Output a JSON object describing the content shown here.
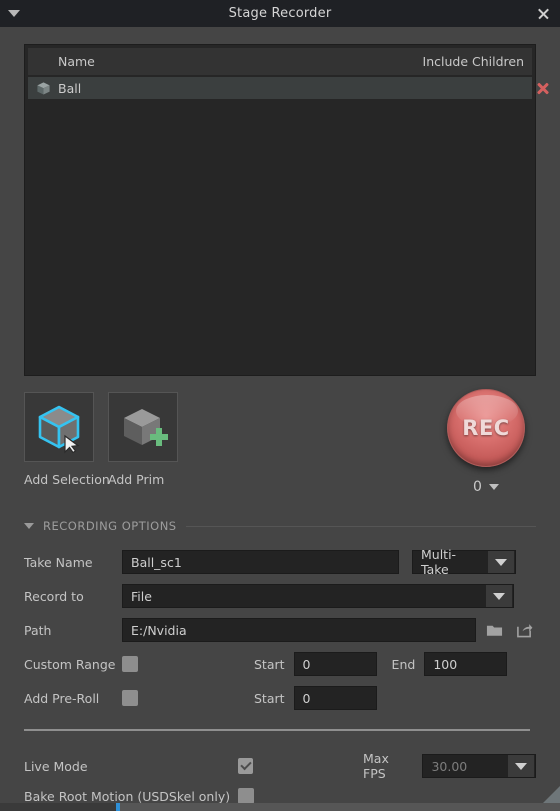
{
  "titlebar": {
    "collapse_icon": "caret-down-icon",
    "title": "Stage Recorder",
    "close_icon": "close-icon"
  },
  "prim_list": {
    "columns": {
      "name": "Name",
      "include_children": "Include Children"
    },
    "rows": [
      {
        "icon": "cube-icon",
        "name": "Ball",
        "delete_icon": "delete-x-icon"
      }
    ]
  },
  "tools": [
    {
      "label": "Add Selection",
      "icon": "cube-selection-icon"
    },
    {
      "label": "Add Prim",
      "icon": "cube-plus-icon"
    }
  ],
  "record": {
    "button_label": "REC",
    "take_count": "0",
    "count_caret": "caret-down-icon"
  },
  "section": {
    "caret": "caret-down-icon",
    "title": "RECORDING OPTIONS"
  },
  "form": {
    "take_name": {
      "label": "Take Name",
      "value": "Ball_sc1",
      "placeholder": "Take Name",
      "mode_value": "Multi-Take",
      "mode_caret": "caret-down-icon"
    },
    "record_to": {
      "label": "Record to",
      "value": "File",
      "caret": "caret-down-icon"
    },
    "path": {
      "label": "Path",
      "value": "E:/Nvidia",
      "placeholder": "Path",
      "browse_icon": "folder-icon",
      "open_icon": "open-external-icon"
    },
    "custom_range": {
      "label": "Custom Range",
      "checked": false,
      "start_label": "Start",
      "start_value": "0",
      "end_label": "End",
      "end_value": "100"
    },
    "pre_roll": {
      "label": "Add Pre-Roll",
      "checked": false,
      "start_label": "Start",
      "start_value": "0"
    }
  },
  "bottom": {
    "live_mode": {
      "label": "Live Mode",
      "checked": true
    },
    "max_fps": {
      "label": "Max FPS",
      "value": "30.00",
      "caret": "caret-down-icon",
      "disabled": true
    },
    "bake_root_motion": {
      "label": "Bake Root Motion (USDSkel only)",
      "checked": false
    }
  },
  "colors": {
    "panel_bg": "#454545",
    "titlebar_bg": "#1f2125",
    "list_bg": "#262626",
    "field_bg": "#232323",
    "accent_blue": "#2e8fd6",
    "rec_red": "#d9706e",
    "delete_red": "#d4605f"
  }
}
